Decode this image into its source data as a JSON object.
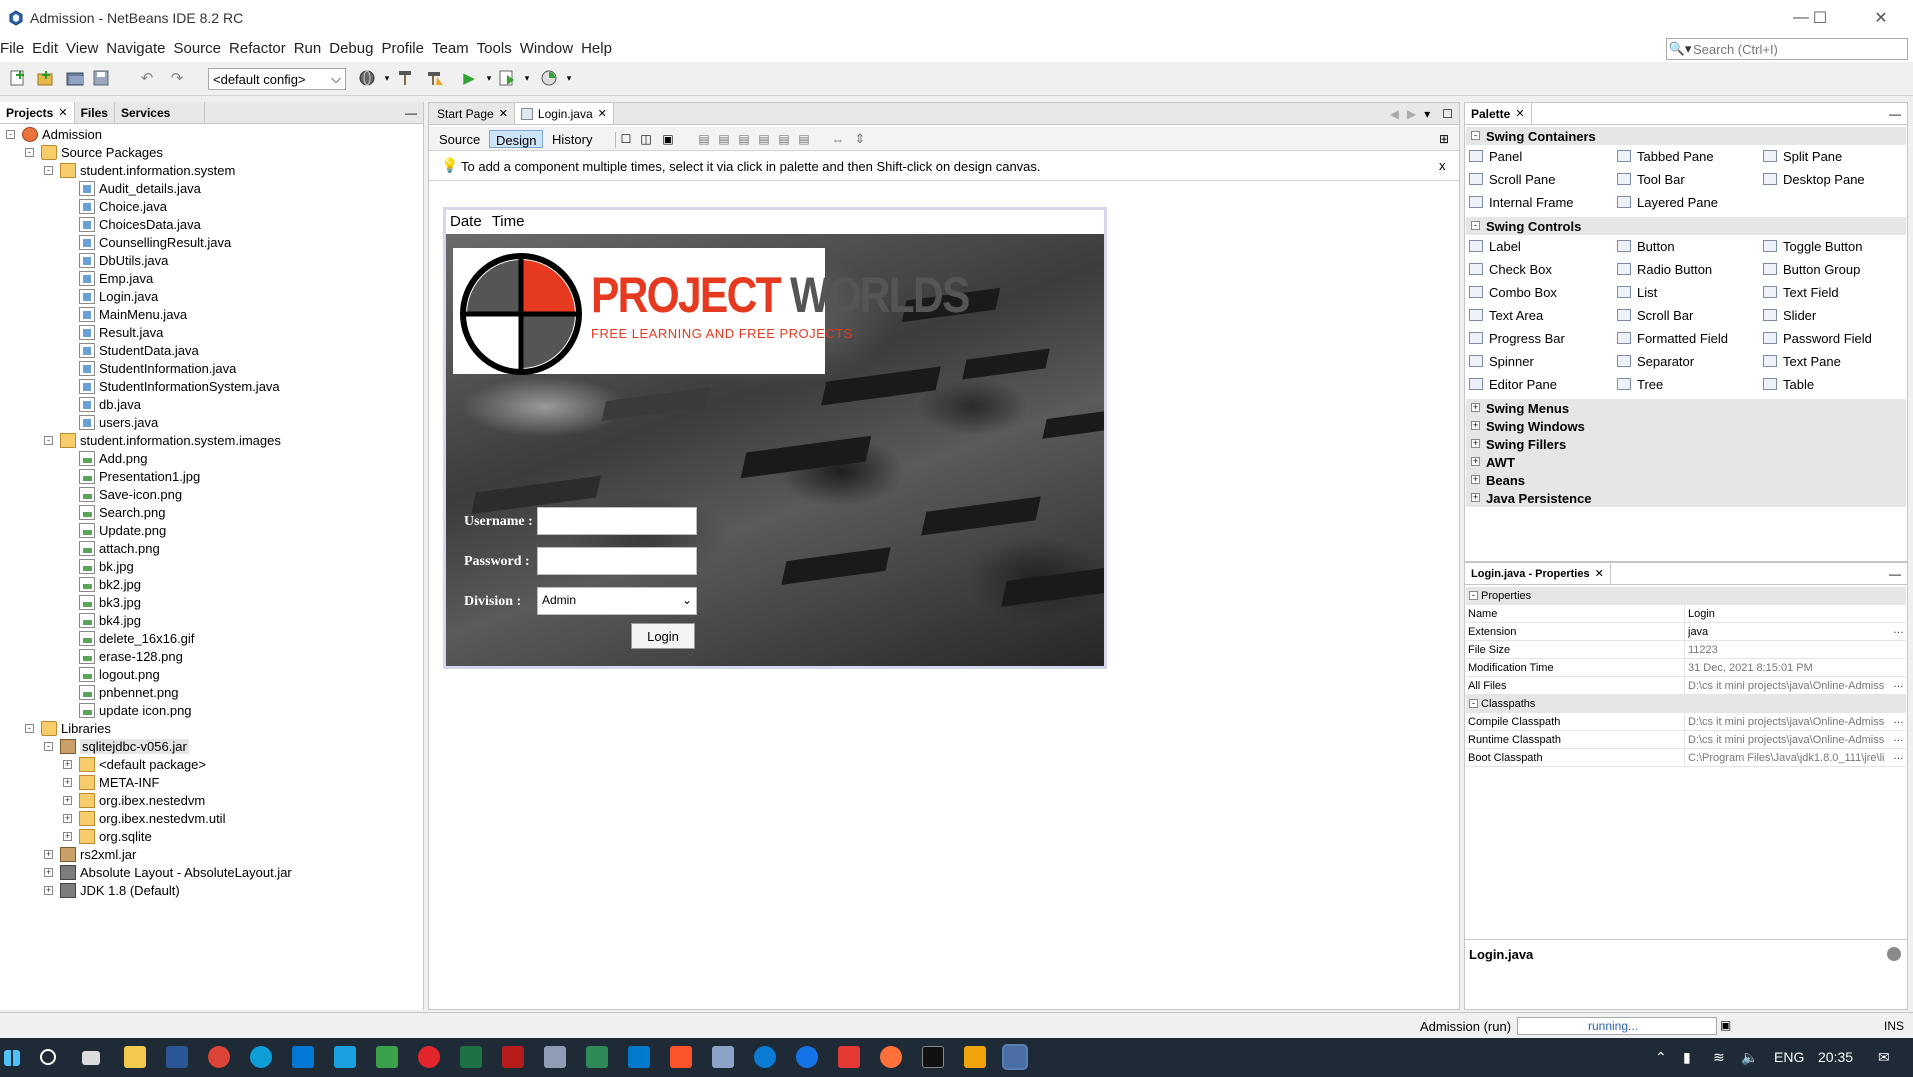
{
  "window": {
    "title": "Admission - NetBeans IDE 8.2 RC"
  },
  "menus": [
    "File",
    "Edit",
    "View",
    "Navigate",
    "Source",
    "Refactor",
    "Run",
    "Debug",
    "Profile",
    "Team",
    "Tools",
    "Window",
    "Help"
  ],
  "search": {
    "placeholder": "Search (Ctrl+I)"
  },
  "toolbar": {
    "config": "<default config>"
  },
  "projects_panel": {
    "tabs": [
      "Projects",
      "Files",
      "Services"
    ],
    "tree": [
      {
        "label": "Admission",
        "type": "project",
        "level": 0,
        "exp": "-"
      },
      {
        "label": "Source Packages",
        "type": "folder",
        "level": 1,
        "exp": "-"
      },
      {
        "label": "student.information.system",
        "type": "pkg",
        "level": 2,
        "exp": "-"
      },
      {
        "label": "Audit_details.java",
        "type": "java",
        "level": 3
      },
      {
        "label": "Choice.java",
        "type": "java",
        "level": 3
      },
      {
        "label": "ChoicesData.java",
        "type": "java",
        "level": 3
      },
      {
        "label": "CounsellingResult.java",
        "type": "java",
        "level": 3
      },
      {
        "label": "DbUtils.java",
        "type": "java",
        "level": 3
      },
      {
        "label": "Emp.java",
        "type": "java",
        "level": 3
      },
      {
        "label": "Login.java",
        "type": "java",
        "level": 3
      },
      {
        "label": "MainMenu.java",
        "type": "java",
        "level": 3
      },
      {
        "label": "Result.java",
        "type": "java",
        "level": 3
      },
      {
        "label": "StudentData.java",
        "type": "java",
        "level": 3
      },
      {
        "label": "StudentInformation.java",
        "type": "java",
        "level": 3
      },
      {
        "label": "StudentInformationSystem.java",
        "type": "java",
        "level": 3
      },
      {
        "label": "db.java",
        "type": "java",
        "level": 3
      },
      {
        "label": "users.java",
        "type": "java",
        "level": 3
      },
      {
        "label": "student.information.system.images",
        "type": "pkg",
        "level": 2,
        "exp": "-"
      },
      {
        "label": "Add.png",
        "type": "png",
        "level": 3
      },
      {
        "label": "Presentation1.jpg",
        "type": "png",
        "level": 3
      },
      {
        "label": "Save-icon.png",
        "type": "png",
        "level": 3
      },
      {
        "label": "Search.png",
        "type": "png",
        "level": 3
      },
      {
        "label": "Update.png",
        "type": "png",
        "level": 3
      },
      {
        "label": "attach.png",
        "type": "png",
        "level": 3
      },
      {
        "label": "bk.jpg",
        "type": "png",
        "level": 3
      },
      {
        "label": "bk2.jpg",
        "type": "png",
        "level": 3
      },
      {
        "label": "bk3.jpg",
        "type": "png",
        "level": 3
      },
      {
        "label": "bk4.jpg",
        "type": "png",
        "level": 3
      },
      {
        "label": "delete_16x16.gif",
        "type": "png",
        "level": 3
      },
      {
        "label": "erase-128.png",
        "type": "png",
        "level": 3
      },
      {
        "label": "logout.png",
        "type": "png",
        "level": 3
      },
      {
        "label": "pnbennet.png",
        "type": "png",
        "level": 3
      },
      {
        "label": "update icon.png",
        "type": "png",
        "level": 3
      },
      {
        "label": "Libraries",
        "type": "folder",
        "level": 1,
        "exp": "-"
      },
      {
        "label": "sqlitejdbc-v056.jar",
        "type": "jar",
        "level": 2,
        "exp": "-",
        "selected": true
      },
      {
        "label": "<default package>",
        "type": "pkg",
        "level": 3,
        "exp": "+"
      },
      {
        "label": "META-INF",
        "type": "pkg",
        "level": 3,
        "exp": "+"
      },
      {
        "label": "org.ibex.nestedvm",
        "type": "pkg",
        "level": 3,
        "exp": "+"
      },
      {
        "label": "org.ibex.nestedvm.util",
        "type": "pkg",
        "level": 3,
        "exp": "+"
      },
      {
        "label": "org.sqlite",
        "type": "pkg",
        "level": 3,
        "exp": "+"
      },
      {
        "label": "rs2xml.jar",
        "type": "jar",
        "level": 2,
        "exp": "+"
      },
      {
        "label": "Absolute Layout - AbsoluteLayout.jar",
        "type": "lib",
        "level": 2,
        "exp": "+"
      },
      {
        "label": "JDK 1.8 (Default)",
        "type": "lib",
        "level": 2,
        "exp": "+"
      }
    ]
  },
  "editor": {
    "tabs": [
      "Start Page",
      "Login.java"
    ],
    "views": [
      "Source",
      "Design",
      "History"
    ],
    "hint": "To add a component multiple times, select it via click in palette and then Shift-click on design canvas.",
    "hint_close": "x",
    "form": {
      "menubar": [
        "Date",
        "Time"
      ],
      "logo_title_1": "PROJECT",
      "logo_title_2": "WORLDS",
      "logo_subtitle": "FREE LEARNING AND FREE PROJECTS",
      "username_label": "Username :",
      "password_label": "Password :",
      "division_label": "Division :",
      "division_value": "Admin",
      "login_button": "Login"
    }
  },
  "palette": {
    "tab": "Palette",
    "categories": [
      {
        "name": "Swing Containers",
        "expanded": true,
        "items": [
          "Panel",
          "Tabbed Pane",
          "Split Pane",
          "Scroll Pane",
          "Tool Bar",
          "Desktop Pane",
          "Internal Frame",
          "Layered Pane"
        ]
      },
      {
        "name": "Swing Controls",
        "expanded": true,
        "items": [
          "Label",
          "Button",
          "Toggle Button",
          "Check Box",
          "Radio Button",
          "Button Group",
          "Combo Box",
          "List",
          "Text Field",
          "Text Area",
          "Scroll Bar",
          "Slider",
          "Progress Bar",
          "Formatted Field",
          "Password Field",
          "Spinner",
          "Separator",
          "Text Pane",
          "Editor Pane",
          "Tree",
          "Table"
        ]
      },
      {
        "name": "Swing Menus",
        "expanded": false
      },
      {
        "name": "Swing Windows",
        "expanded": false
      },
      {
        "name": "Swing Fillers",
        "expanded": false
      },
      {
        "name": "AWT",
        "expanded": false
      },
      {
        "name": "Beans",
        "expanded": false
      },
      {
        "name": "Java Persistence",
        "expanded": false
      }
    ]
  },
  "properties": {
    "tab": "Login.java - Properties",
    "section_props": "Properties",
    "rows1": [
      {
        "k": "Name",
        "v": "Login",
        "dark": true
      },
      {
        "k": "Extension",
        "v": "java",
        "dark": true,
        "dots": true
      },
      {
        "k": "File Size",
        "v": "11223"
      },
      {
        "k": "Modification Time",
        "v": "31 Dec, 2021 8:15:01 PM"
      },
      {
        "k": "All Files",
        "v": "D:\\cs it mini projects\\java\\Online-Admiss...",
        "dots": true
      }
    ],
    "section_cp": "Classpaths",
    "rows2": [
      {
        "k": "Compile Classpath",
        "v": "D:\\cs it mini projects\\java\\Online-Admiss...",
        "dots": true
      },
      {
        "k": "Runtime Classpath",
        "v": "D:\\cs it mini projects\\java\\Online-Admiss...",
        "dots": true
      },
      {
        "k": "Boot Classpath",
        "v": "C:\\Program Files\\Java\\jdk1.8.0_111\\jre\\li...",
        "dots": true
      }
    ],
    "footer_title": "Login.java"
  },
  "status": {
    "run": "Admission (run)",
    "progress": "running...",
    "mode": "INS"
  },
  "taskbar": {
    "lang": "ENG",
    "time": "20:35"
  }
}
